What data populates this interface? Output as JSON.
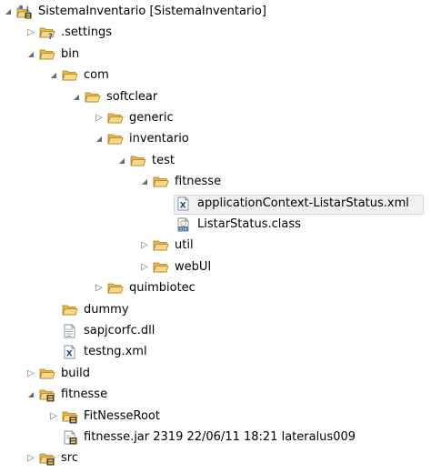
{
  "tree": [
    {
      "label": "SistemaInventario [SistemaInventario]",
      "depth": 0,
      "twisty": "expanded",
      "icon": "project-icon",
      "interactive": true
    },
    {
      "label": ".settings",
      "depth": 1,
      "twisty": "collapsed",
      "icon": "folder-unknown-icon",
      "interactive": true
    },
    {
      "label": "bin",
      "depth": 1,
      "twisty": "expanded",
      "icon": "folder-icon",
      "interactive": true
    },
    {
      "label": "com",
      "depth": 2,
      "twisty": "expanded",
      "icon": "folder-icon",
      "interactive": true
    },
    {
      "label": "softclear",
      "depth": 3,
      "twisty": "expanded",
      "icon": "folder-icon",
      "interactive": true
    },
    {
      "label": "generic",
      "depth": 4,
      "twisty": "collapsed",
      "icon": "folder-icon",
      "interactive": true
    },
    {
      "label": "inventario",
      "depth": 4,
      "twisty": "expanded",
      "icon": "folder-icon",
      "interactive": true
    },
    {
      "label": "test",
      "depth": 5,
      "twisty": "expanded",
      "icon": "folder-icon",
      "interactive": true
    },
    {
      "label": "fitnesse",
      "depth": 6,
      "twisty": "expanded",
      "icon": "folder-icon",
      "interactive": true
    },
    {
      "label": "applicationContext-ListarStatus.xml",
      "depth": 7,
      "twisty": "none",
      "icon": "xml-file-icon",
      "interactive": true,
      "selected": true
    },
    {
      "label": "ListarStatus.class",
      "depth": 7,
      "twisty": "none",
      "icon": "class-file-icon",
      "interactive": true
    },
    {
      "label": "util",
      "depth": 6,
      "twisty": "collapsed",
      "icon": "folder-icon",
      "interactive": true
    },
    {
      "label": "webUI",
      "depth": 6,
      "twisty": "collapsed",
      "icon": "folder-icon",
      "interactive": true
    },
    {
      "label": "quimbiotec",
      "depth": 4,
      "twisty": "collapsed",
      "icon": "folder-icon",
      "interactive": true
    },
    {
      "label": "dummy",
      "depth": 2,
      "twisty": "none",
      "icon": "folder-icon",
      "interactive": true
    },
    {
      "label": "sapjcorfc.dll",
      "depth": 2,
      "twisty": "none",
      "icon": "text-file-icon",
      "interactive": true
    },
    {
      "label": "testng.xml",
      "depth": 2,
      "twisty": "none",
      "icon": "xml-file-icon",
      "interactive": true
    },
    {
      "label": "build",
      "depth": 1,
      "twisty": "collapsed",
      "icon": "folder-icon",
      "interactive": true
    },
    {
      "label": "fitnesse",
      "depth": 1,
      "twisty": "expanded",
      "icon": "folder-versioned-icon",
      "interactive": true
    },
    {
      "label": "FitNesseRoot",
      "depth": 2,
      "twisty": "collapsed",
      "icon": "folder-versioned-icon",
      "interactive": true
    },
    {
      "label": "fitnesse.jar 2319  22/06/11 18:21  lateralus009",
      "depth": 2,
      "twisty": "none",
      "icon": "jar-versioned-icon",
      "interactive": true
    },
    {
      "label": "src",
      "depth": 1,
      "twisty": "collapsed",
      "icon": "folder-versioned-icon",
      "interactive": true
    }
  ],
  "colors": {
    "folder_body": "#e8b84a",
    "folder_tab": "#d49a22",
    "folder_front": "#f6d889",
    "twisty": "#6b6b6b",
    "selection_bg": "#f0f0f0",
    "selection_border": "#d8d8d8"
  }
}
